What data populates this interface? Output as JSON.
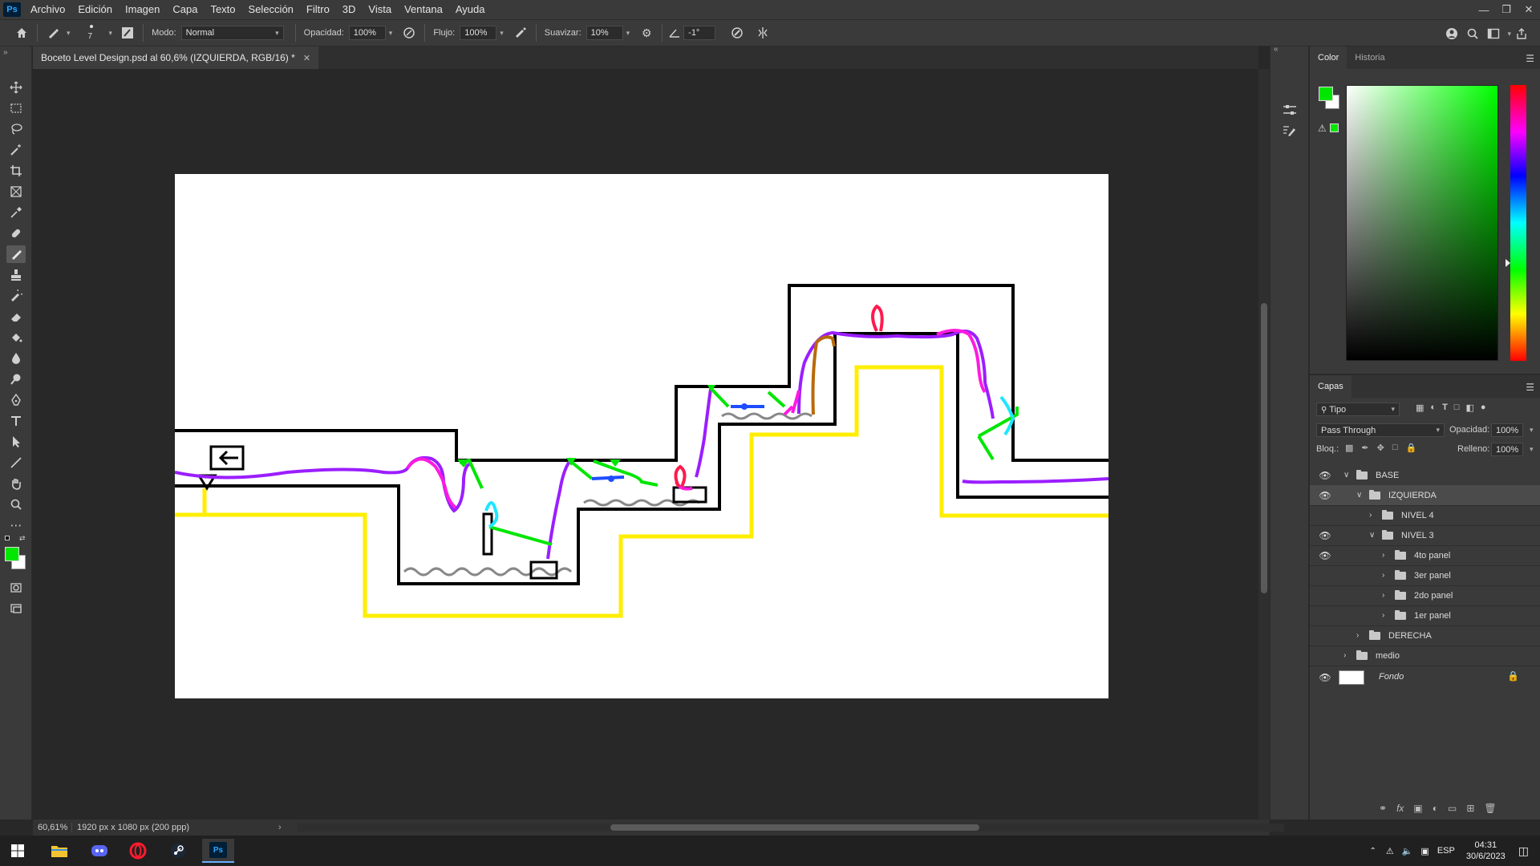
{
  "menubar": {
    "logo": "Ps",
    "items": [
      "Archivo",
      "Edición",
      "Imagen",
      "Capa",
      "Texto",
      "Selección",
      "Filtro",
      "3D",
      "Vista",
      "Ventana",
      "Ayuda"
    ]
  },
  "options": {
    "brush_size": "7",
    "mode_label": "Modo:",
    "mode_value": "Normal",
    "opacity_label": "Opacidad:",
    "opacity_value": "100%",
    "flow_label": "Flujo:",
    "flow_value": "100%",
    "smoothing_label": "Suavizar:",
    "smoothing_value": "10%",
    "angle_value": "-1°"
  },
  "document": {
    "tab_title": "Boceto Level Design.psd al 60,6% (IZQUIERDA, RGB/16) *",
    "zoom": "60,61%",
    "info": "1920 px x 1080 px (200 ppp)"
  },
  "color_panel": {
    "tabs": [
      "Color",
      "Historia"
    ],
    "foreground": "#00e600",
    "background": "#ffffff",
    "hue": "#00ff00"
  },
  "layers_panel": {
    "title": "Capas",
    "filter_value": "Tipo",
    "blend_mode": "Pass Through",
    "opacity_label": "Opacidad:",
    "opacity_value": "100%",
    "lock_label": "Bloq.:",
    "fill_label": "Relleno:",
    "fill_value": "100%",
    "layers": [
      {
        "name": "BASE",
        "visible": true,
        "level": 0,
        "expanded": true
      },
      {
        "name": "IZQUIERDA",
        "visible": true,
        "level": 1,
        "expanded": true,
        "selected": true
      },
      {
        "name": "NIVEL 4",
        "visible": false,
        "level": 2,
        "expanded": false
      },
      {
        "name": "NIVEL 3",
        "visible": true,
        "level": 2,
        "expanded": true
      },
      {
        "name": "4to panel",
        "visible": true,
        "level": 3,
        "expanded": false
      },
      {
        "name": "3er panel",
        "visible": false,
        "level": 3,
        "expanded": false
      },
      {
        "name": "2do panel",
        "visible": false,
        "level": 3,
        "expanded": false
      },
      {
        "name": "1er panel",
        "visible": false,
        "level": 3,
        "expanded": false
      },
      {
        "name": "DERECHA",
        "visible": false,
        "level": 1,
        "expanded": false
      },
      {
        "name": "medio",
        "visible": false,
        "level": 0,
        "expanded": false
      }
    ],
    "background_layer": "Fondo"
  },
  "taskbar": {
    "language": "ESP",
    "time": "04:31",
    "date": "30/6/2023"
  }
}
